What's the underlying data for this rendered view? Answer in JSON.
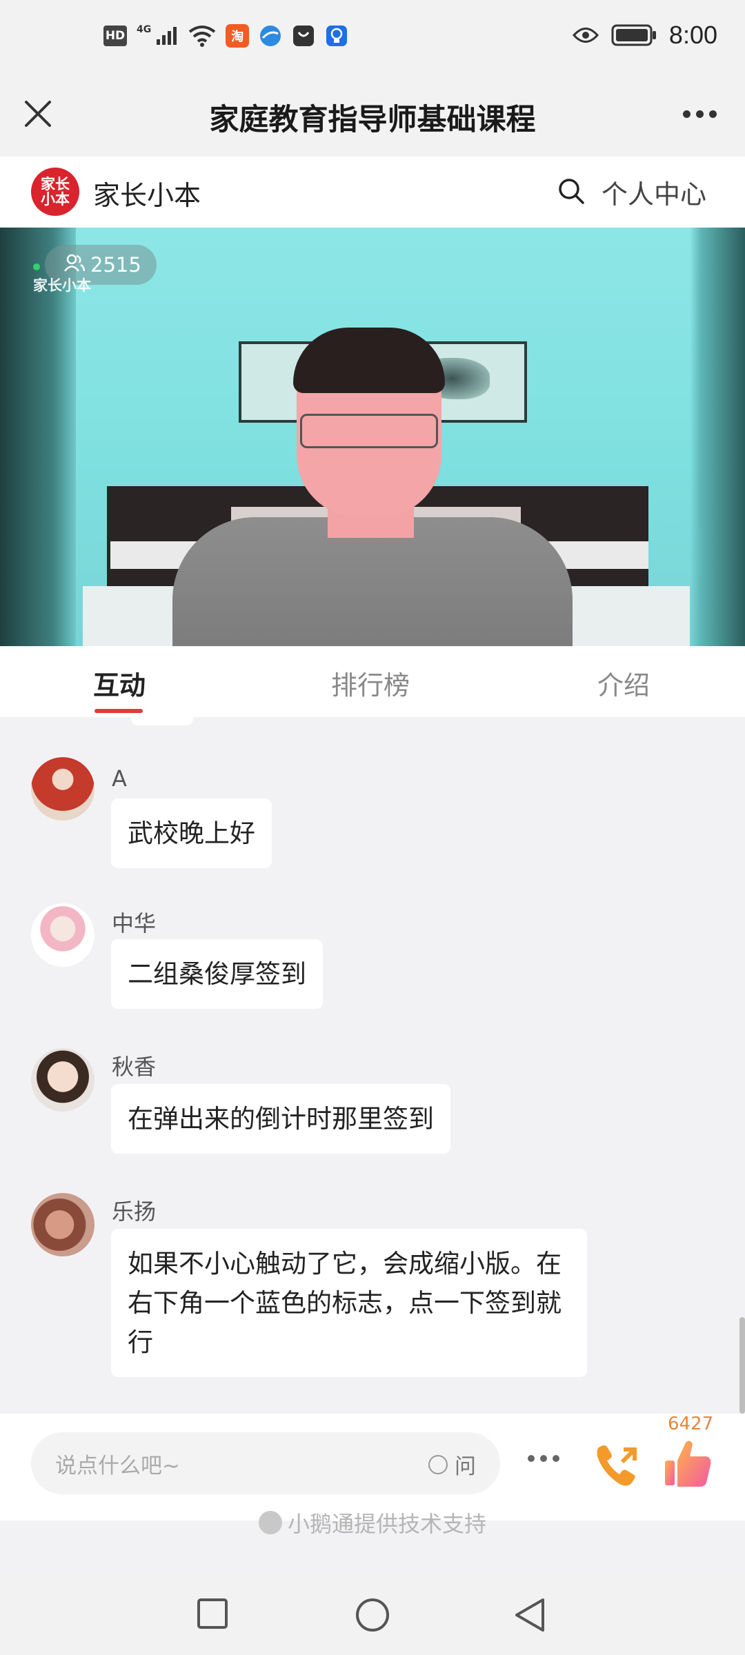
{
  "status_bar": {
    "time": "8:00",
    "icons": [
      "hd-icon",
      "signal-4g-icon",
      "wifi-icon",
      "taobao-icon",
      "browser-icon",
      "bag-icon",
      "lightbulb-icon",
      "eye-icon",
      "battery-icon"
    ],
    "hd_label": "HD",
    "net_label": "4G",
    "taobao_label": "淘"
  },
  "titlebar": {
    "title": "家庭教育指导师基础课程"
  },
  "shop": {
    "logo_line1": "家长",
    "logo_line2": "小本",
    "name": "家长小本",
    "personal_center": "个人中心"
  },
  "video": {
    "viewer_count": "2515",
    "watermark": "家长小本"
  },
  "tabs": {
    "items": [
      "互动",
      "排行榜",
      "介绍"
    ],
    "active": 0
  },
  "messages": [
    {
      "user": "A",
      "text": "武校晚上好"
    },
    {
      "user": "中华",
      "text": "二组桑俊厚签到"
    },
    {
      "user": "秋香",
      "text": "在弹出来的倒计时那里签到"
    },
    {
      "user": "乐扬",
      "text": "如果不小心触动了它，会成缩小版。在右下角一个蓝色的标志，点一下签到就行"
    }
  ],
  "input": {
    "placeholder": "说点什么吧~",
    "ask_label": "问"
  },
  "like_count": "6427",
  "support_text": "小鹅通提供技术支持",
  "colors": {
    "accent_red": "#e23b3b",
    "like_orange": "#e6863b",
    "brand_red": "#d9232d"
  }
}
